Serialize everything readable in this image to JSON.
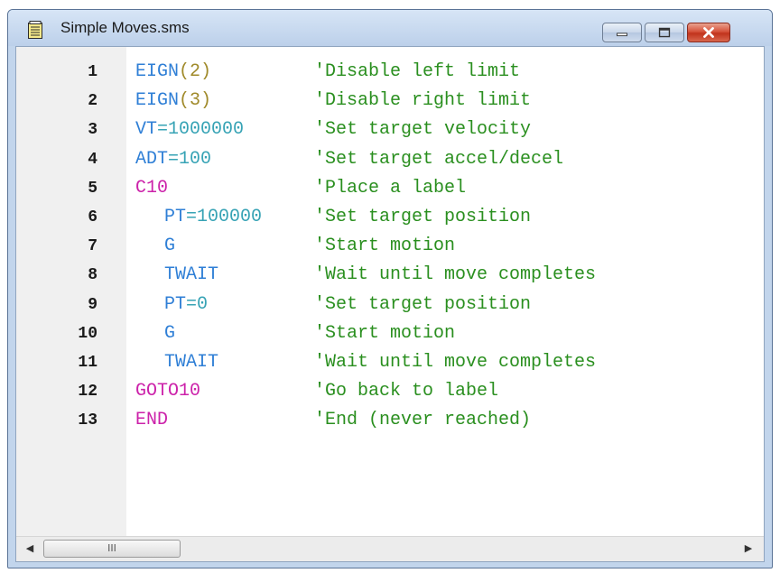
{
  "window": {
    "title": "Simple Moves.sms",
    "icon": "document-icon",
    "controls": [
      "minimize-icon",
      "maximize-icon",
      "close-icon"
    ]
  },
  "colors": {
    "command_blue": "#2f7fd6",
    "number_teal": "#37a3b5",
    "label_magenta": "#cc22aa",
    "comment_green": "#2a8f1f",
    "paren_olive": "#a08a2a"
  },
  "lines": [
    {
      "num": "1",
      "parts": [
        {
          "t": "EIGN",
          "c": "blue"
        },
        {
          "t": "(2)",
          "c": "olive"
        }
      ],
      "comment": "'Disable left limit"
    },
    {
      "num": "2",
      "parts": [
        {
          "t": "EIGN",
          "c": "blue"
        },
        {
          "t": "(3)",
          "c": "olive"
        }
      ],
      "comment": "'Disable right limit"
    },
    {
      "num": "3",
      "parts": [
        {
          "t": "VT",
          "c": "blue"
        },
        {
          "t": "=",
          "c": "teal"
        },
        {
          "t": "1000000",
          "c": "teal"
        }
      ],
      "comment": "'Set target velocity"
    },
    {
      "num": "4",
      "parts": [
        {
          "t": "ADT",
          "c": "blue"
        },
        {
          "t": "=",
          "c": "teal"
        },
        {
          "t": "100",
          "c": "teal"
        }
      ],
      "comment": "'Set target accel/decel"
    },
    {
      "num": "5",
      "parts": [
        {
          "t": "C10",
          "c": "magenta"
        }
      ],
      "comment": "'Place a label"
    },
    {
      "num": "6",
      "indent": true,
      "parts": [
        {
          "t": "PT",
          "c": "blue"
        },
        {
          "t": "=",
          "c": "teal"
        },
        {
          "t": "100000",
          "c": "teal"
        }
      ],
      "comment": "'Set target position"
    },
    {
      "num": "7",
      "indent": true,
      "parts": [
        {
          "t": "G",
          "c": "blue"
        }
      ],
      "comment": "'Start motion"
    },
    {
      "num": "8",
      "indent": true,
      "parts": [
        {
          "t": "TWAIT",
          "c": "blue"
        }
      ],
      "comment": "'Wait until move completes"
    },
    {
      "num": "9",
      "indent": true,
      "parts": [
        {
          "t": "PT",
          "c": "blue"
        },
        {
          "t": "=",
          "c": "teal"
        },
        {
          "t": "0",
          "c": "teal"
        }
      ],
      "comment": "'Set target position"
    },
    {
      "num": "10",
      "indent": true,
      "parts": [
        {
          "t": "G",
          "c": "blue"
        }
      ],
      "comment": "'Start motion"
    },
    {
      "num": "11",
      "indent": true,
      "parts": [
        {
          "t": "TWAIT",
          "c": "blue"
        }
      ],
      "comment": "'Wait until move completes"
    },
    {
      "num": "12",
      "parts": [
        {
          "t": "GOTO10",
          "c": "magenta"
        }
      ],
      "comment": "'Go back to label"
    },
    {
      "num": "13",
      "parts": [
        {
          "t": "END",
          "c": "magenta"
        }
      ],
      "comment": "'End (never reached)"
    }
  ],
  "scrollbar": {
    "left_arrow": "◀",
    "right_arrow": "▶",
    "thumb_grip": "III"
  }
}
